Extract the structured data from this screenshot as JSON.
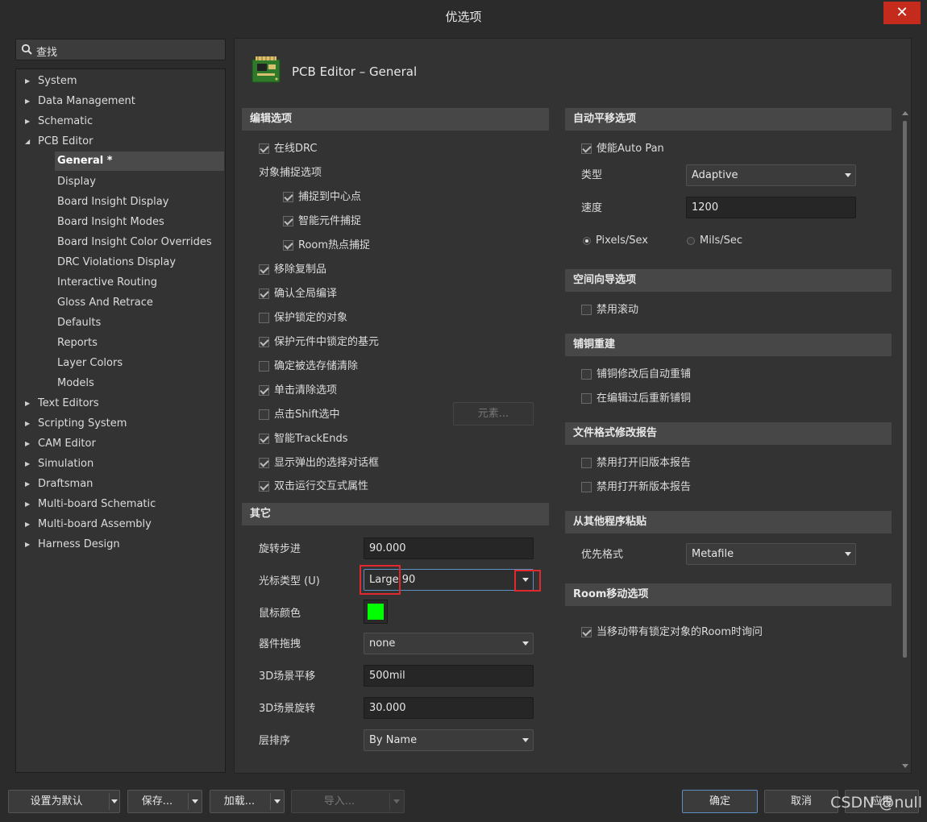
{
  "window": {
    "title": "优选项",
    "close_glyph": "✕"
  },
  "search": {
    "placeholder": "查找"
  },
  "tree": {
    "items": [
      {
        "label": "System",
        "expandable": true
      },
      {
        "label": "Data Management",
        "expandable": true
      },
      {
        "label": "Schematic",
        "expandable": true
      },
      {
        "label": "PCB Editor",
        "expandable": true,
        "expanded": true
      },
      {
        "label": "General *",
        "child": true,
        "selected": true
      },
      {
        "label": "Display",
        "child": true
      },
      {
        "label": "Board Insight Display",
        "child": true
      },
      {
        "label": "Board Insight Modes",
        "child": true
      },
      {
        "label": "Board Insight Color Overrides",
        "child": true
      },
      {
        "label": "DRC Violations Display",
        "child": true
      },
      {
        "label": "Interactive Routing",
        "child": true
      },
      {
        "label": "Gloss And Retrace",
        "child": true
      },
      {
        "label": "Defaults",
        "child": true
      },
      {
        "label": "Reports",
        "child": true
      },
      {
        "label": "Layer Colors",
        "child": true
      },
      {
        "label": "Models",
        "child": true
      },
      {
        "label": "Text Editors",
        "expandable": true
      },
      {
        "label": "Scripting System",
        "expandable": true
      },
      {
        "label": "CAM Editor",
        "expandable": true
      },
      {
        "label": "Simulation",
        "expandable": true
      },
      {
        "label": "Draftsman",
        "expandable": true
      },
      {
        "label": "Multi-board Schematic",
        "expandable": true
      },
      {
        "label": "Multi-board Assembly",
        "expandable": true
      },
      {
        "label": "Harness Design",
        "expandable": true
      }
    ]
  },
  "header": {
    "title": "PCB Editor – General",
    "icon": "pcb-board-icon"
  },
  "edit": {
    "section": "编辑选项",
    "online_drc": {
      "label": "在线DRC",
      "checked": true
    },
    "snap_title": "对象捕捉选项",
    "snap_center": {
      "label": "捕捉到中心点",
      "checked": true
    },
    "smart_component": {
      "label": "智能元件捕捉",
      "checked": true
    },
    "room_hotspot": {
      "label": "Room热点捕捉",
      "checked": true
    },
    "remove_dup": {
      "label": "移除复制品",
      "checked": true
    },
    "confirm_global": {
      "label": "确认全局编译",
      "checked": true
    },
    "protect_locked": {
      "label": "保护锁定的对象",
      "checked": false
    },
    "protect_primitives": {
      "label": "保护元件中锁定的基元",
      "checked": true
    },
    "confirm_clear": {
      "label": "确定被选存储清除",
      "checked": false
    },
    "click_clear": {
      "label": "单击清除选项",
      "checked": true
    },
    "shift_select": {
      "label": "点击Shift选中",
      "checked": false
    },
    "primitives_btn": "元素...",
    "smart_track": {
      "label": "智能TrackEnds",
      "checked": true
    },
    "show_popup": {
      "label": "显示弹出的选择对话框",
      "checked": true
    },
    "dbl_click": {
      "label": "双击运行交互式属性",
      "checked": true
    }
  },
  "other": {
    "section": "其它",
    "rotation_label": "旋转步进",
    "rotation_value": "90.000",
    "cursor_label": "光标类型 (U)",
    "cursor_value": "Large 90",
    "mouse_color_label": "鼠标颜色",
    "mouse_color": "#00ff00",
    "drag_label": "器件拖拽",
    "drag_value": "none",
    "pan3d_label": "3D场景平移",
    "pan3d_value": "500mil",
    "rot3d_label": "3D场景旋转",
    "rot3d_value": "30.000",
    "layer_order_label": "层排序",
    "layer_order_value": "By Name"
  },
  "autopan": {
    "section": "自动平移选项",
    "enable": {
      "label": "使能Auto Pan",
      "checked": true
    },
    "type_label": "类型",
    "type_value": "Adaptive",
    "speed_label": "速度",
    "speed_value": "1200",
    "pixels": {
      "label": "Pixels/Sex",
      "selected": true
    },
    "mils": {
      "label": "Mils/Sec",
      "selected": false
    }
  },
  "space_nav": {
    "section": "空间向导选项",
    "disable_roll": {
      "label": "禁用滚动",
      "checked": false
    }
  },
  "polygon": {
    "section": "铺铜重建",
    "repour_after_modify": {
      "label": "铺铜修改后自动重铺",
      "checked": false
    },
    "repour_after_edit": {
      "label": "在编辑过后重新铺铜",
      "checked": false
    }
  },
  "file_format": {
    "section": "文件格式修改报告",
    "disable_old": {
      "label": "禁用打开旧版本报告",
      "checked": false
    },
    "disable_new": {
      "label": "禁用打开新版本报告",
      "checked": false
    }
  },
  "paste": {
    "section": "从其他程序粘贴",
    "pref_label": "优先格式",
    "pref_value": "Metafile"
  },
  "room_move": {
    "section": "Room移动选项",
    "ask_locked": {
      "label": "当移动带有锁定对象的Room时询问",
      "checked": true
    }
  },
  "footer": {
    "set_default": "设置为默认",
    "save": "保存...",
    "load": "加载...",
    "import": "导入...",
    "ok": "确定",
    "cancel": "取消",
    "apply": "应用"
  },
  "watermark": "CSDN @null"
}
